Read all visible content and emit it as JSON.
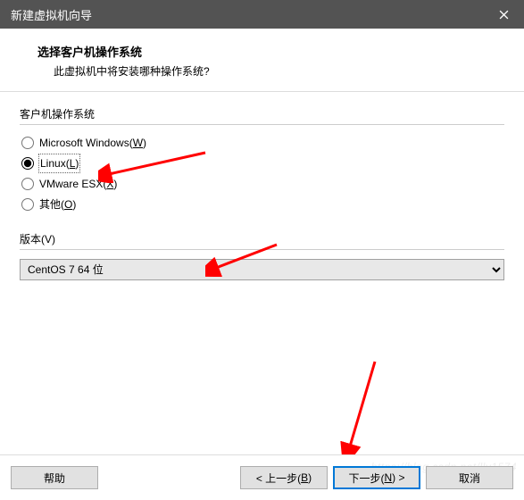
{
  "titlebar": {
    "title": "新建虚拟机向导"
  },
  "header": {
    "title": "选择客户机操作系统",
    "subtitle": "此虚拟机中将安装哪种操作系统?"
  },
  "osGroup": {
    "label": "客户机操作系统",
    "options": {
      "windows": {
        "text": "Microsoft Windows(",
        "accel": "W",
        "suffix": ")"
      },
      "linux": {
        "text": "Linux(",
        "accel": "L",
        "suffix": ")"
      },
      "esx": {
        "text": "VMware ESX(",
        "accel": "X",
        "suffix": ")"
      },
      "other": {
        "text": "其他(",
        "accel": "O",
        "suffix": ")"
      }
    },
    "selected": "linux"
  },
  "version": {
    "label_text": "版本(",
    "label_accel": "V",
    "label_suffix": ")",
    "selected": "CentOS 7 64 位"
  },
  "buttons": {
    "help": "帮助",
    "back_pre": "< 上一步(",
    "back_accel": "B",
    "back_suf": ")",
    "next_pre": "下一步(",
    "next_accel": "N",
    "next_suf": ") >",
    "cancel": "取消"
  },
  "watermark": "https://blog.csdn.net/lly1574"
}
